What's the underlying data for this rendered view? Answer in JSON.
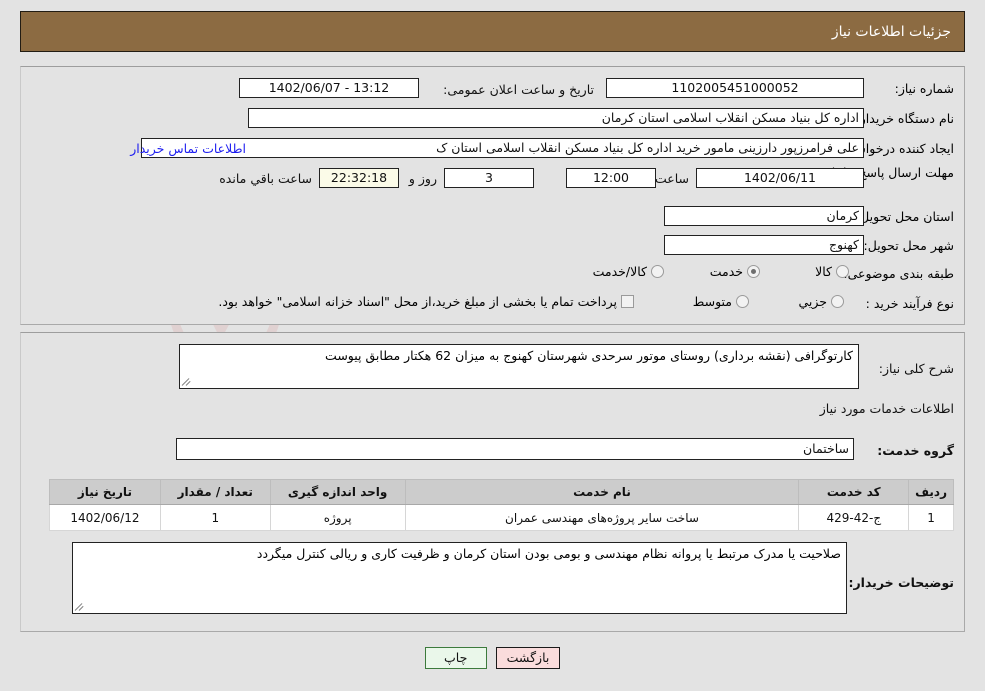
{
  "header": {
    "title": "جزئیات اطلاعات نیاز"
  },
  "main": {
    "fields": {
      "need_number": {
        "label": "شماره نیاز:",
        "value": "1102005451000052"
      },
      "announce_datetime": {
        "label": "تاریخ و ساعت اعلان عمومی:",
        "value": "13:12 - 1402/06/07"
      },
      "buyer_org": {
        "label": "نام دستگاه خریدار:",
        "value": "اداره کل بنیاد مسکن انقلاب اسلامی استان کرمان"
      },
      "requester": {
        "label": "ایجاد کننده درخواست:",
        "value": "علی فرامرزپور دارزینی مامور خرید اداره کل بنیاد مسکن انقلاب اسلامی استان ک"
      },
      "contact_link": "اطلاعات تماس خریدار",
      "deadline": {
        "label": "مهلت ارسال پاسخ: تا تاریخ:",
        "date": "1402/06/11",
        "time_label": "ساعت",
        "time": "12:00",
        "days": "3",
        "days_label": "روز و",
        "timer": "22:32:18",
        "timer_label": "ساعت باقي مانده"
      },
      "province": {
        "label": "استان محل تحویل:",
        "value": "کرمان"
      },
      "city": {
        "label": "شهر محل تحویل:",
        "value": "کهنوج"
      }
    },
    "category": {
      "label": "طبقه بندی موضوعی:",
      "options": [
        {
          "label": "کالا",
          "selected": false
        },
        {
          "label": "خدمت",
          "selected": true
        },
        {
          "label": "کالا/خدمت",
          "selected": false
        }
      ]
    },
    "purchase_type": {
      "label": "نوع فرآیند خرید :",
      "options": [
        {
          "label": "جزیي",
          "selected": false
        },
        {
          "label": "متوسط",
          "selected": false
        }
      ],
      "treasury_checkbox": {
        "checked": false,
        "label": "پرداخت تمام یا بخشی از مبلغ خرید،از محل \"اسناد خزانه اسلامی\" خواهد بود."
      }
    }
  },
  "details": {
    "summary": {
      "label": "شرح کلی نیاز:",
      "value": "کارتوگرافی (نقشه برداری) روستای موتور سرحدی شهرستان کهنوج به میزان 62 هکتار مطابق پیوست"
    },
    "section_title": "اطلاعات خدمات مورد نیاز",
    "service_group": {
      "label": "گروه خدمت:",
      "value": "ساختمان"
    },
    "table": {
      "columns": [
        "ردیف",
        "کد خدمت",
        "نام خدمت",
        "واحد اندازه گیری",
        "تعداد / مقدار",
        "تاریخ نیاز"
      ],
      "rows": [
        [
          "1",
          "ج-42-429",
          "ساخت سایر پروژه‌های مهندسی عمران",
          "پروژه",
          "1",
          "1402/06/12"
        ]
      ]
    },
    "buyer_notes": {
      "label": "توضیحات خریدار:",
      "value": "صلاحیت یا مدرک مرتبط یا پروانه نظام مهندسی و بومی بودن استان کرمان و ظرفیت کاری و ریالی کنترل میگردد"
    }
  },
  "buttons": {
    "print": "چاپ",
    "back": "بازگشت"
  },
  "watermark": {
    "text": "AriaTender.net"
  }
}
